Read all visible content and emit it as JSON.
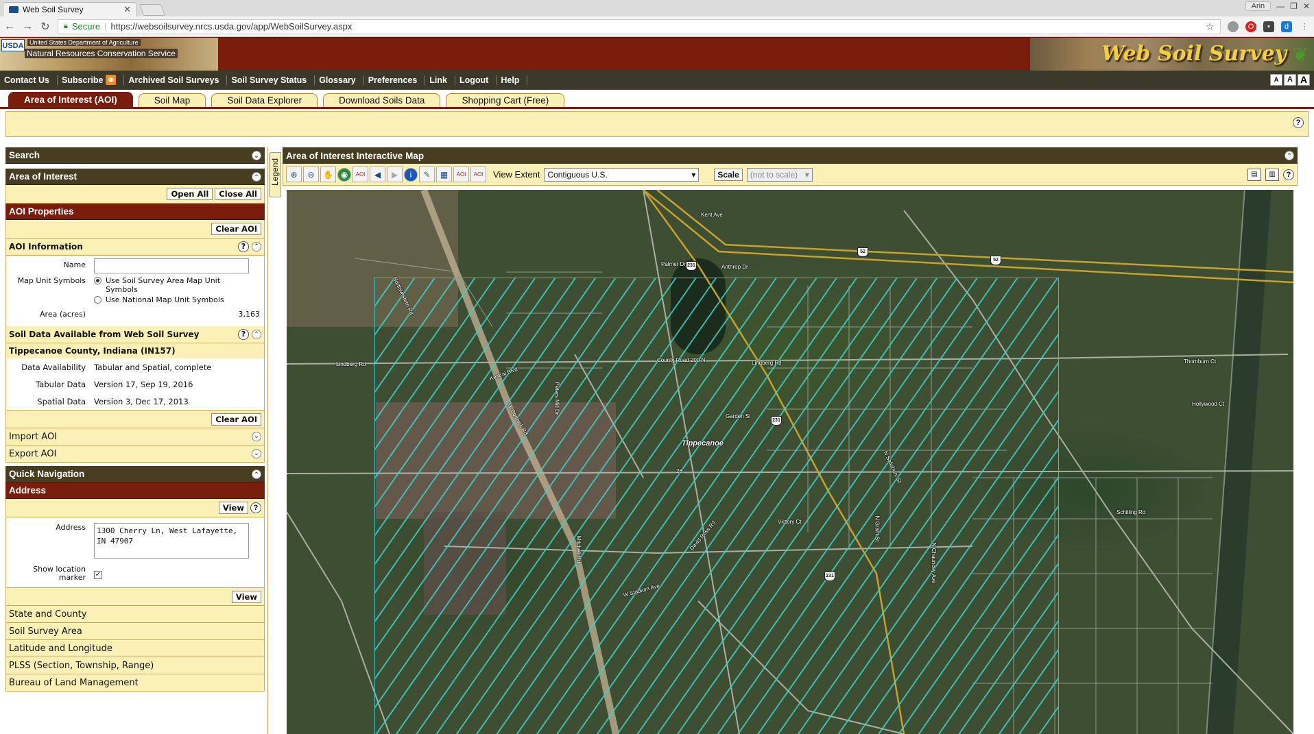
{
  "browser": {
    "tab_title": "Web Soil Survey",
    "secure_label": "Secure",
    "url": "https://websoilsurvey.nrcs.usda.gov/app/WebSoilSurvey.aspx",
    "user_label": "Arin"
  },
  "header": {
    "usda_mark": "USDA",
    "dept_text": "United States Department of Agriculture",
    "agency_text": "Natural Resources Conservation Service",
    "brand_title": "Web Soil Survey"
  },
  "mainnav": {
    "items": [
      "Contact Us",
      "Subscribe",
      "Archived Soil Surveys",
      "Soil Survey Status",
      "Glossary",
      "Preferences",
      "Link",
      "Logout",
      "Help"
    ],
    "font_sizes": [
      "A",
      "A",
      "A"
    ]
  },
  "apptabs": [
    "Area of Interest (AOI)",
    "Soil Map",
    "Soil Data Explorer",
    "Download Soils Data",
    "Shopping Cart (Free)"
  ],
  "left": {
    "search_title": "Search",
    "aoi_title": "Area of Interest",
    "open_all": "Open All",
    "close_all": "Close All",
    "aoi_props_title": "AOI Properties",
    "clear_aoi": "Clear AOI",
    "aoi_info_title": "AOI Information",
    "name_label": "Name",
    "name_value": "",
    "mus_label": "Map Unit Symbols",
    "mus_option1": "Use Soil Survey Area Map Unit Symbols",
    "mus_option2": "Use National Map Unit Symbols",
    "area_label": "Area (acres)",
    "area_value": "3,163",
    "soil_data_title": "Soil Data Available from Web Soil Survey",
    "county": "Tippecanoe County, Indiana (IN157)",
    "data_availability_label": "Data Availability",
    "data_availability_value": "Tabular and Spatial, complete",
    "tabular_label": "Tabular Data",
    "tabular_value": "Version 17, Sep 19, 2016",
    "spatial_label": "Spatial Data",
    "spatial_value": "Version 3, Dec 17, 2013",
    "clear_aoi2": "Clear AOI",
    "import_aoi": "Import AOI",
    "export_aoi": "Export AOI",
    "quick_nav_title": "Quick Navigation",
    "address_title": "Address",
    "view_label": "View",
    "address_label": "Address",
    "address_value": "1300 Cherry Ln, West Lafayette, IN 47907",
    "show_marker_label": "Show location marker",
    "view_label2": "View",
    "nav_items": [
      "State and County",
      "Soil Survey Area",
      "Latitude and Longitude",
      "PLSS (Section, Township, Range)",
      "Bureau of Land Management"
    ]
  },
  "legend_label": "Legend",
  "map": {
    "title": "Area of Interest Interactive Map",
    "view_extent_label": "View Extent",
    "view_extent_value": "Contiguous U.S.",
    "scale_label": "Scale",
    "scale_value": "(not to scale)",
    "labels": {
      "tippecanoe": "Tippecanoe",
      "county_road": "County Road 200 N",
      "lindberg_w": "Lindberg Rd",
      "lindberg_e": "Lindberg Rd",
      "kestral": "Kestral Blvd",
      "mccormick": "McCormick Rd",
      "gardens": "Garden St",
      "sunset": "N Salisbury St",
      "stadium": "W Stadium Ave",
      "anthrop": "Anthrop Dr",
      "palmer": "Palmer Dr",
      "kent": "Kent Ave",
      "thornburn": "Thornburn Ct",
      "hollywood": "Hollywood Ct",
      "northwestern": "Northwestern Rd",
      "victory": "Victory Ct",
      "schilling": "Schilling Rd",
      "n_grant": "N Grant St",
      "chauncey": "N Chauncey Ave",
      "david_ross": "David Ross Rd",
      "mccarty": "Mitchell Rd",
      "peters_mill": "Peters Mill Dr"
    },
    "shields": [
      "231",
      "231",
      "231",
      "52",
      "52",
      "26"
    ]
  }
}
